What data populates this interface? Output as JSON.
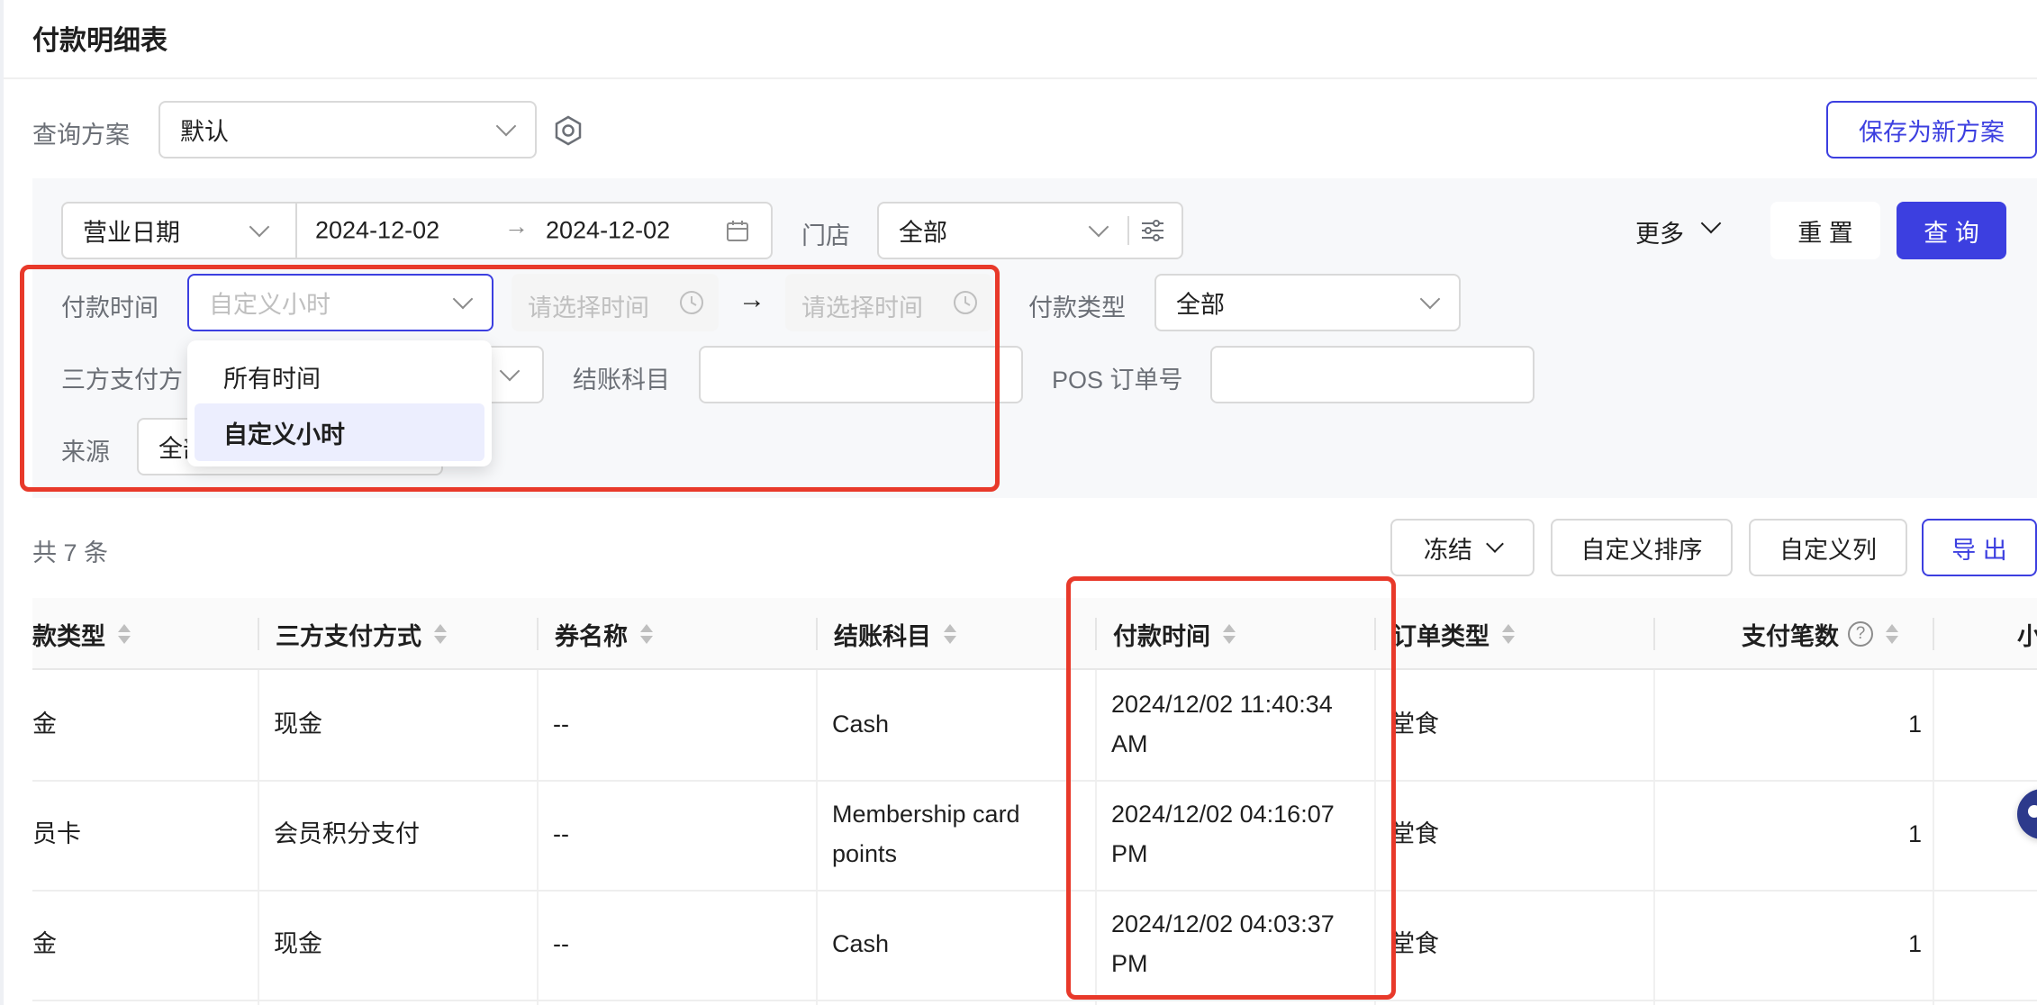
{
  "page": {
    "title": "付款明细表"
  },
  "toolbar": {
    "scheme_label": "查询方案",
    "scheme_value": "默认",
    "save_new_scheme": "保存为新方案"
  },
  "filters": {
    "date_type": "营业日期",
    "date_start": "2024-12-02",
    "date_end": "2024-12-02",
    "store_label": "门店",
    "store_value": "全部",
    "more": "更多",
    "reset": "重 置",
    "query": "查 询",
    "pay_time_label": "付款时间",
    "pay_time_placeholder": "自定义小时",
    "time_start_placeholder": "请选择时间",
    "time_end_placeholder": "请选择时间",
    "pay_type_label": "付款类型",
    "pay_type_value": "全部",
    "third_party_label": "三方支付方",
    "settle_subject_label": "结账科目",
    "settle_subject_value": "",
    "pos_order_label": "POS 订单号",
    "pos_order_value": "",
    "source_label": "来源",
    "source_value": "全部"
  },
  "dropdown": {
    "options": [
      "所有时间",
      "自定义小时"
    ],
    "selected": "自定义小时"
  },
  "table_toolbar": {
    "total": "共 7 条",
    "freeze": "冻结",
    "custom_sort": "自定义排序",
    "custom_columns": "自定义列",
    "export": "导 出"
  },
  "table": {
    "columns": [
      "款类型",
      "三方支付方式",
      "券名称",
      "结账科目",
      "付款时间",
      "订单类型",
      "支付笔数",
      "小"
    ],
    "rows": [
      {
        "pay_type": "金",
        "third_party": "现金",
        "coupon": "--",
        "subject": "Cash",
        "pay_time_1": "2024/12/02 11:40:34",
        "pay_time_2": "AM",
        "order_type": "堂食",
        "count": "1"
      },
      {
        "pay_type": "员卡",
        "third_party": "会员积分支付",
        "coupon": "--",
        "subject_1": "Membership card",
        "subject_2": "points",
        "pay_time_1": "2024/12/02 04:16:07",
        "pay_time_2": "PM",
        "order_type": "堂食",
        "count": "1"
      },
      {
        "pay_type": "金",
        "third_party": "现金",
        "coupon": "--",
        "subject": "Cash",
        "pay_time_1": "2024/12/02 04:03:37",
        "pay_time_2": "PM",
        "order_type": "堂食",
        "count": "1"
      }
    ]
  },
  "colors": {
    "primary": "#3c3fe0",
    "highlight": "#e8392a"
  }
}
